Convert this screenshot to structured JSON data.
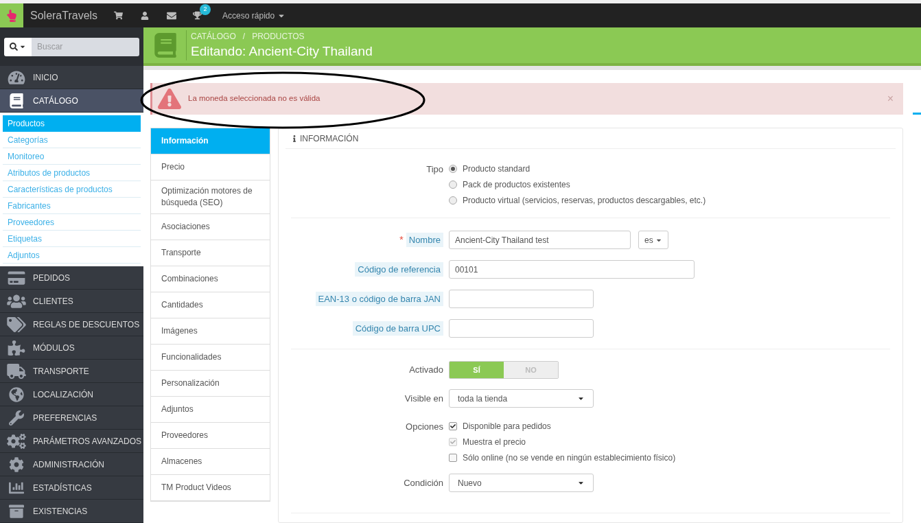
{
  "topbar": {
    "shop_name": "SoleraTravels",
    "trophy_badge": "2",
    "quick_access": "Acceso rápido"
  },
  "sidebar": {
    "search": {
      "placeholder": "Buscar"
    },
    "menu": [
      {
        "label": "INICIO",
        "selected": false
      },
      {
        "label": "CATÁLOGO",
        "selected": true,
        "expanded": true,
        "children": [
          {
            "label": "Productos",
            "selected": true
          },
          {
            "label": "Categorías",
            "selected": false
          },
          {
            "label": "Monitoreo",
            "selected": false
          },
          {
            "label": "Atributos de productos",
            "selected": false
          },
          {
            "label": "Características de productos",
            "selected": false
          },
          {
            "label": "Fabricantes",
            "selected": false
          },
          {
            "label": "Proveedores",
            "selected": false
          },
          {
            "label": "Etiquetas",
            "selected": false
          },
          {
            "label": "Adjuntos",
            "selected": false
          }
        ]
      },
      {
        "label": "PEDIDOS",
        "selected": false
      },
      {
        "label": "CLIENTES",
        "selected": false
      },
      {
        "label": "REGLAS DE DESCUENTOS",
        "selected": false
      },
      {
        "label": "MÓDULOS",
        "selected": false
      },
      {
        "label": "TRANSPORTE",
        "selected": false
      },
      {
        "label": "LOCALIZACIÓN",
        "selected": false
      },
      {
        "label": "PREFERENCIAS",
        "selected": false
      },
      {
        "label": "PARÁMETROS AVANZADOS",
        "selected": false
      },
      {
        "label": "ADMINISTRACIÓN",
        "selected": false
      },
      {
        "label": "ESTADÍSTICAS",
        "selected": false
      },
      {
        "label": "EXISTENCIAS",
        "selected": false
      }
    ]
  },
  "header": {
    "breadcrumb": [
      "CATÁLOGO",
      "PRODUCTOS"
    ],
    "separator": "/",
    "title": "Editando: Ancient-City Thailand"
  },
  "alert": {
    "message": "La moneda seleccionada no es válida",
    "close": "×"
  },
  "tabs": [
    {
      "label": "Información",
      "selected": true
    },
    {
      "label": "Precio",
      "selected": false
    },
    {
      "label": "Optimización motores de búsqueda (SEO)",
      "selected": false
    },
    {
      "label": "Asociaciones",
      "selected": false
    },
    {
      "label": "Transporte",
      "selected": false
    },
    {
      "label": "Combinaciones",
      "selected": false
    },
    {
      "label": "Cantidades",
      "selected": false
    },
    {
      "label": "Imágenes",
      "selected": false
    },
    {
      "label": "Funcionalidades",
      "selected": false
    },
    {
      "label": "Personalización",
      "selected": false
    },
    {
      "label": "Adjuntos",
      "selected": false
    },
    {
      "label": "Proveedores",
      "selected": false
    },
    {
      "label": "Almacenes",
      "selected": false
    },
    {
      "label": "TM Product Videos",
      "selected": false
    }
  ],
  "panel": {
    "heading": "INFORMACIÓN",
    "type": {
      "label": "Tipo",
      "options": [
        {
          "label": "Producto standard",
          "selected": true
        },
        {
          "label": "Pack de productos existentes",
          "selected": false
        },
        {
          "label": "Producto virtual (servicios, reservas, productos descargables, etc.)",
          "selected": false
        }
      ]
    },
    "fields": [
      {
        "label": "Nombre",
        "required_mark": "*",
        "value": "Ancient-City Thailand test",
        "language": "es",
        "wide": false
      },
      {
        "label": "Código de referencia",
        "value": "00101",
        "wide": true
      },
      {
        "label": "EAN-13 o código de barra JAN",
        "wide": false
      },
      {
        "label": "Código de barra UPC",
        "wide": false
      }
    ],
    "enabled": {
      "label": "Activado",
      "options": [
        {
          "label": "SÍ",
          "selected": true
        },
        {
          "label": "NO",
          "selected": false
        }
      ]
    },
    "visibility": {
      "label": "Visible en",
      "value": "toda la tienda"
    },
    "options": {
      "label": "Opciones",
      "items": [
        {
          "label": "Disponible para pedidos",
          "checked": true,
          "disabled": false
        },
        {
          "label": "Muestra el precio",
          "checked": true,
          "disabled": true
        },
        {
          "label": "Sólo online (no se vende en ningún establecimiento físico)",
          "checked": false,
          "disabled": false
        }
      ]
    },
    "condition": {
      "label": "Condición",
      "value": "Nuevo"
    }
  }
}
